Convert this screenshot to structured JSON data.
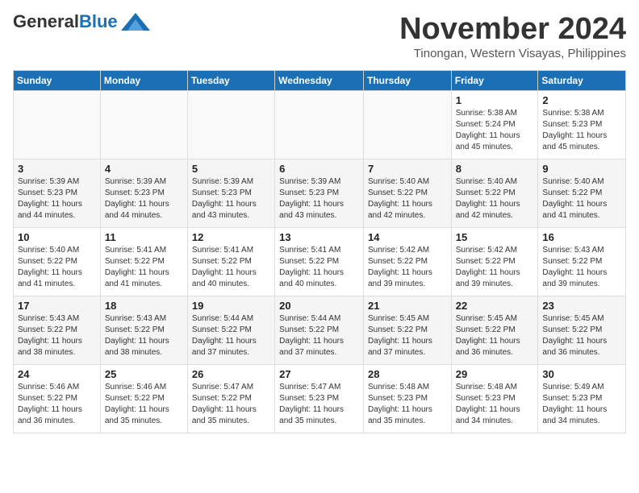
{
  "header": {
    "logo_general": "General",
    "logo_blue": "Blue",
    "month_title": "November 2024",
    "location": "Tinongan, Western Visayas, Philippines"
  },
  "weekdays": [
    "Sunday",
    "Monday",
    "Tuesday",
    "Wednesday",
    "Thursday",
    "Friday",
    "Saturday"
  ],
  "weeks": [
    [
      {
        "day": "",
        "info": ""
      },
      {
        "day": "",
        "info": ""
      },
      {
        "day": "",
        "info": ""
      },
      {
        "day": "",
        "info": ""
      },
      {
        "day": "",
        "info": ""
      },
      {
        "day": "1",
        "info": "Sunrise: 5:38 AM\nSunset: 5:24 PM\nDaylight: 11 hours and 45 minutes."
      },
      {
        "day": "2",
        "info": "Sunrise: 5:38 AM\nSunset: 5:23 PM\nDaylight: 11 hours and 45 minutes."
      }
    ],
    [
      {
        "day": "3",
        "info": "Sunrise: 5:39 AM\nSunset: 5:23 PM\nDaylight: 11 hours and 44 minutes."
      },
      {
        "day": "4",
        "info": "Sunrise: 5:39 AM\nSunset: 5:23 PM\nDaylight: 11 hours and 44 minutes."
      },
      {
        "day": "5",
        "info": "Sunrise: 5:39 AM\nSunset: 5:23 PM\nDaylight: 11 hours and 43 minutes."
      },
      {
        "day": "6",
        "info": "Sunrise: 5:39 AM\nSunset: 5:23 PM\nDaylight: 11 hours and 43 minutes."
      },
      {
        "day": "7",
        "info": "Sunrise: 5:40 AM\nSunset: 5:22 PM\nDaylight: 11 hours and 42 minutes."
      },
      {
        "day": "8",
        "info": "Sunrise: 5:40 AM\nSunset: 5:22 PM\nDaylight: 11 hours and 42 minutes."
      },
      {
        "day": "9",
        "info": "Sunrise: 5:40 AM\nSunset: 5:22 PM\nDaylight: 11 hours and 41 minutes."
      }
    ],
    [
      {
        "day": "10",
        "info": "Sunrise: 5:40 AM\nSunset: 5:22 PM\nDaylight: 11 hours and 41 minutes."
      },
      {
        "day": "11",
        "info": "Sunrise: 5:41 AM\nSunset: 5:22 PM\nDaylight: 11 hours and 41 minutes."
      },
      {
        "day": "12",
        "info": "Sunrise: 5:41 AM\nSunset: 5:22 PM\nDaylight: 11 hours and 40 minutes."
      },
      {
        "day": "13",
        "info": "Sunrise: 5:41 AM\nSunset: 5:22 PM\nDaylight: 11 hours and 40 minutes."
      },
      {
        "day": "14",
        "info": "Sunrise: 5:42 AM\nSunset: 5:22 PM\nDaylight: 11 hours and 39 minutes."
      },
      {
        "day": "15",
        "info": "Sunrise: 5:42 AM\nSunset: 5:22 PM\nDaylight: 11 hours and 39 minutes."
      },
      {
        "day": "16",
        "info": "Sunrise: 5:43 AM\nSunset: 5:22 PM\nDaylight: 11 hours and 39 minutes."
      }
    ],
    [
      {
        "day": "17",
        "info": "Sunrise: 5:43 AM\nSunset: 5:22 PM\nDaylight: 11 hours and 38 minutes."
      },
      {
        "day": "18",
        "info": "Sunrise: 5:43 AM\nSunset: 5:22 PM\nDaylight: 11 hours and 38 minutes."
      },
      {
        "day": "19",
        "info": "Sunrise: 5:44 AM\nSunset: 5:22 PM\nDaylight: 11 hours and 37 minutes."
      },
      {
        "day": "20",
        "info": "Sunrise: 5:44 AM\nSunset: 5:22 PM\nDaylight: 11 hours and 37 minutes."
      },
      {
        "day": "21",
        "info": "Sunrise: 5:45 AM\nSunset: 5:22 PM\nDaylight: 11 hours and 37 minutes."
      },
      {
        "day": "22",
        "info": "Sunrise: 5:45 AM\nSunset: 5:22 PM\nDaylight: 11 hours and 36 minutes."
      },
      {
        "day": "23",
        "info": "Sunrise: 5:45 AM\nSunset: 5:22 PM\nDaylight: 11 hours and 36 minutes."
      }
    ],
    [
      {
        "day": "24",
        "info": "Sunrise: 5:46 AM\nSunset: 5:22 PM\nDaylight: 11 hours and 36 minutes."
      },
      {
        "day": "25",
        "info": "Sunrise: 5:46 AM\nSunset: 5:22 PM\nDaylight: 11 hours and 35 minutes."
      },
      {
        "day": "26",
        "info": "Sunrise: 5:47 AM\nSunset: 5:22 PM\nDaylight: 11 hours and 35 minutes."
      },
      {
        "day": "27",
        "info": "Sunrise: 5:47 AM\nSunset: 5:23 PM\nDaylight: 11 hours and 35 minutes."
      },
      {
        "day": "28",
        "info": "Sunrise: 5:48 AM\nSunset: 5:23 PM\nDaylight: 11 hours and 35 minutes."
      },
      {
        "day": "29",
        "info": "Sunrise: 5:48 AM\nSunset: 5:23 PM\nDaylight: 11 hours and 34 minutes."
      },
      {
        "day": "30",
        "info": "Sunrise: 5:49 AM\nSunset: 5:23 PM\nDaylight: 11 hours and 34 minutes."
      }
    ]
  ]
}
